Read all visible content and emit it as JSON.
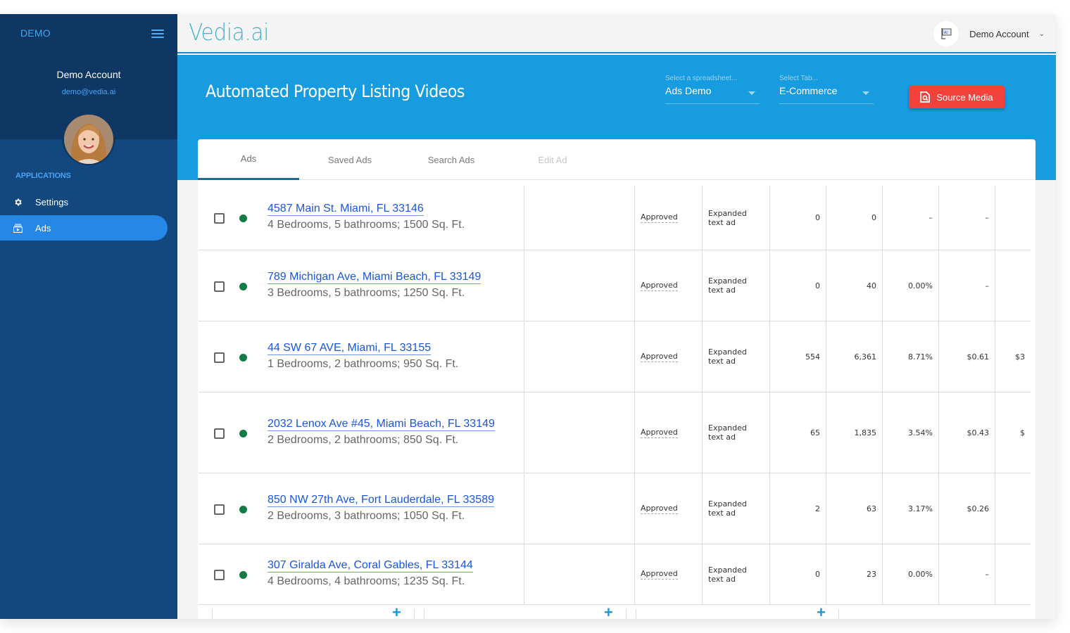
{
  "sidebar": {
    "brand": "DEMO",
    "account_name": "Demo Account",
    "account_email": "demo@vedia.ai",
    "section_label": "APPLICATIONS",
    "items": [
      {
        "label": "Settings",
        "icon": "gear-icon",
        "active": false
      },
      {
        "label": "Ads",
        "icon": "video-stack-icon",
        "active": true
      }
    ]
  },
  "topbar": {
    "logo": "Vedia.ai",
    "user_name": "Demo Account"
  },
  "header": {
    "title": "Automated Property Listing Videos",
    "spreadsheet_select": {
      "label": "Select a spreadsheet...",
      "value": "Ads Demo"
    },
    "tab_select": {
      "label": "Select Tab...",
      "value": "E-Commerce"
    },
    "source_button": "Source Media"
  },
  "tabs": [
    {
      "label": "Ads",
      "state": "active"
    },
    {
      "label": "Saved Ads",
      "state": "normal"
    },
    {
      "label": "Search Ads",
      "state": "normal"
    },
    {
      "label": "Edit Ad",
      "state": "disabled"
    }
  ],
  "colors": {
    "sidebar_dark": "#0e3764",
    "sidebar": "#12487e",
    "active_nav": "#2587e6",
    "header_band": "#189ce0",
    "source_button": "#f2423b",
    "status_dot": "#137c44",
    "link": "#1a56db"
  },
  "rows": [
    {
      "address": "4587 Main St. Miami, FL 33146",
      "details": "4 Bedrooms, 5 bathrooms; 1500 Sq. Ft.",
      "status": "Approved",
      "type": "Expanded text ad",
      "c1": "0",
      "c2": "0",
      "c3": "–",
      "c4": "–",
      "c5": ""
    },
    {
      "address": "789 Michigan Ave, Miami Beach, FL 33149",
      "details": "3 Bedrooms, 5 bathrooms; 1250 Sq. Ft.",
      "status": "Approved",
      "type": "Expanded text ad",
      "c1": "0",
      "c2": "40",
      "c3": "0.00%",
      "c4": "–",
      "c5": ""
    },
    {
      "address": "44 SW 67 AVE, Miami, FL 33155",
      "details": "1 Bedrooms, 2 bathrooms; 950 Sq. Ft.",
      "status": "Approved",
      "type": "Expanded text ad",
      "c1": "554",
      "c2": "6,361",
      "c3": "8.71%",
      "c4": "$0.61",
      "c5": "$3"
    },
    {
      "address": "2032 Lenox Ave #45, Miami Beach, FL 33149",
      "details": "2 Bedrooms, 2 bathrooms; 850 Sq. Ft.",
      "status": "Approved",
      "type": "Expanded text ad",
      "c1": "65",
      "c2": "1,835",
      "c3": "3.54%",
      "c4": "$0.43",
      "c5": "$"
    },
    {
      "address": "850 NW 27th Ave, Fort Lauderdale, FL 33589",
      "details": "2 Bedrooms, 3 bathrooms; 1050 Sq. Ft.",
      "status": "Approved",
      "type": "Expanded text ad",
      "c1": "2",
      "c2": "63",
      "c3": "3.17%",
      "c4": "$0.26",
      "c5": ""
    },
    {
      "address": "307 Giralda Ave, Coral Gables, FL 33144",
      "details": "4 Bedrooms, 4 bathrooms; 1235 Sq. Ft.",
      "status": "Approved",
      "type": "Expanded text ad",
      "c1": "0",
      "c2": "23",
      "c3": "0.00%",
      "c4": "–",
      "c5": ""
    }
  ],
  "footer": {
    "add_label": "+"
  }
}
